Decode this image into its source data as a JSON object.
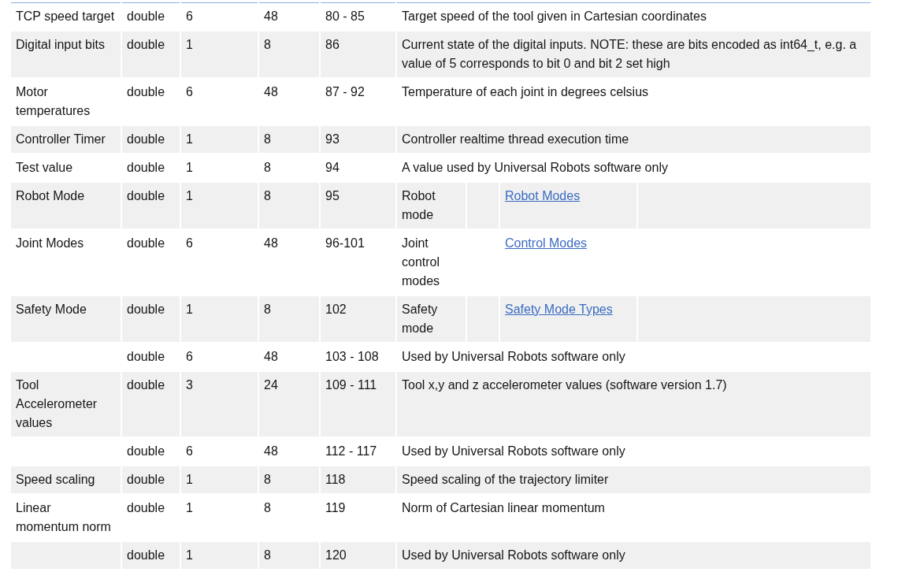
{
  "table": {
    "rows": [
      {
        "name": "TCP speed target",
        "type": "double",
        "count": "6",
        "bytes": "48",
        "index": "80 - 85",
        "kind": "text",
        "description": "Target speed of the tool given in Cartesian coordinates"
      },
      {
        "name": "Digital input bits",
        "type": "double",
        "count": "1",
        "bytes": "8",
        "index": "86",
        "kind": "text",
        "description": "Current state of the digital inputs. NOTE: these are bits encoded as int64_t, e.g. a value of 5 corresponds to bit 0 and bit 2 set high"
      },
      {
        "name": "Motor temperatures",
        "type": "double",
        "count": "6",
        "bytes": "48",
        "index": "87 - 92",
        "kind": "text",
        "description": "Temperature of each joint in degrees celsius"
      },
      {
        "name": "Controller Timer",
        "type": "double",
        "count": "1",
        "bytes": "8",
        "index": "93",
        "kind": "text",
        "description": "Controller realtime thread execution time"
      },
      {
        "name": "Test value",
        "type": "double",
        "count": "1",
        "bytes": "8",
        "index": "94",
        "kind": "text",
        "description": "A value used by Universal Robots software only"
      },
      {
        "name": "Robot Mode",
        "type": "double",
        "count": "1",
        "bytes": "8",
        "index": "95",
        "kind": "link",
        "description": "Robot mode",
        "link": "Robot Modes"
      },
      {
        "name": "Joint Modes",
        "type": "double",
        "count": "6",
        "bytes": "48",
        "index": "96-101",
        "kind": "link",
        "description": "Joint control modes",
        "link": "Control Modes"
      },
      {
        "name": "Safety Mode",
        "type": "double",
        "count": "1",
        "bytes": "8",
        "index": "102",
        "kind": "link",
        "description": "Safety mode",
        "link": "Safety Mode Types"
      },
      {
        "type": "double",
        "count": "6",
        "bytes": "48",
        "index": "103 - 108",
        "kind": "text",
        "description": "Used by Universal Robots software only"
      },
      {
        "name": "Tool Accelerometer values",
        "type": "double",
        "count": "3",
        "bytes": "24",
        "index": "109 - 111",
        "kind": "text",
        "description": "Tool x,y and z accelerometer values (software version 1.7)"
      },
      {
        "type": "double",
        "count": "6",
        "bytes": "48",
        "index": "112 - 117",
        "kind": "text",
        "description": "Used by Universal Robots software only"
      },
      {
        "name": "Speed scaling",
        "type": "double",
        "count": "1",
        "bytes": "8",
        "index": "118",
        "kind": "text",
        "description": "Speed scaling of the trajectory limiter"
      },
      {
        "name": "Linear momentum norm",
        "type": "double",
        "count": "1",
        "bytes": "8",
        "index": "119",
        "kind": "text",
        "description": "Norm of Cartesian linear momentum"
      },
      {
        "type": "double",
        "count": "1",
        "bytes": "8",
        "index": "120",
        "kind": "text",
        "description": "Used by Universal Robots software only"
      }
    ]
  }
}
